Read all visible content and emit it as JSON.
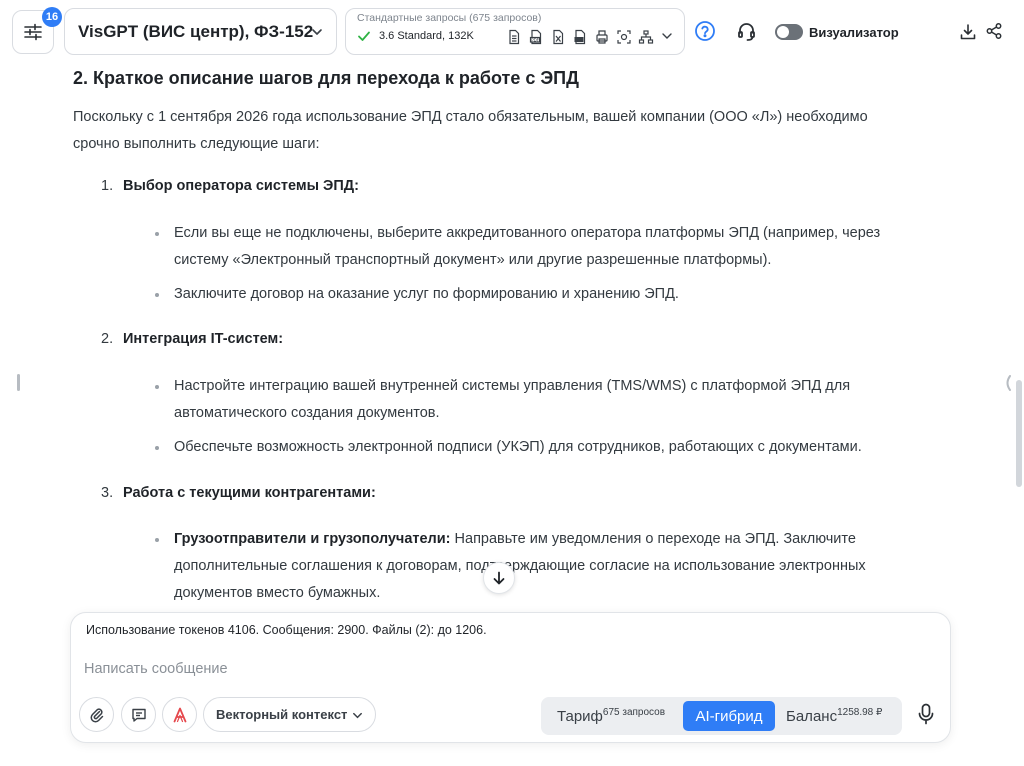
{
  "header": {
    "badge_count": "16",
    "model_name": "VisGPT (ВИС центр), ФЗ-152",
    "requests_title": "Стандартные запросы (675 запросов)",
    "requests_model": "3.6 Standard, 132K",
    "visualizer_label": "Визуализатор",
    "visualizer_on": false,
    "accent_color": "#2f7df6"
  },
  "article": {
    "heading": "2. Краткое описание шагов для перехода к работе с ЭПД",
    "intro": "Поскольку с 1 сентября 2026 года использование ЭПД стало обязательным, вашей компании (ООО «Л») необходимо срочно выполнить следующие шаги:",
    "steps": [
      {
        "num": "1.",
        "title": "Выбор оператора системы ЭПД:",
        "bullets": [
          "Если вы еще не подключены, выберите аккредитованного оператора платформы ЭПД (например, через систему «Электронный транспортный документ» или другие разрешенные платформы).",
          "Заключите договор на оказание услуг по формированию и хранению ЭПД."
        ]
      },
      {
        "num": "2.",
        "title": "Интеграция IT-систем:",
        "bullets": [
          "Настройте интеграцию вашей внутренней системы управления (TMS/WMS) с платформой ЭПД для автоматического создания документов.",
          "Обеспечьте возможность электронной подписи (УКЭП) для сотрудников, работающих с документами."
        ]
      },
      {
        "num": "3.",
        "title": "Работа с текущими контрагентами:",
        "bullets": [
          {
            "bold": "Грузоотправители и грузополучатели:",
            "text": " Направьте им уведомления о переходе на ЭПД. Заключите дополнительные соглашения к договорам, подтверждающие согласие на использование электронных документов вместо бумажных."
          }
        ]
      }
    ]
  },
  "composer": {
    "token_info": "Использование токенов 4106. Сообщения: 2900. Файлы (2): до 1206.",
    "placeholder": "Написать сообщение",
    "value": "",
    "vector_context_label": "Векторный контекст",
    "tariff_label": "Тариф",
    "tariff_sup": "675 запросов",
    "ai_hybrid_label": "AI-гибрид",
    "balance_label": "Баланс",
    "balance_sup": "1258.98 ₽"
  }
}
